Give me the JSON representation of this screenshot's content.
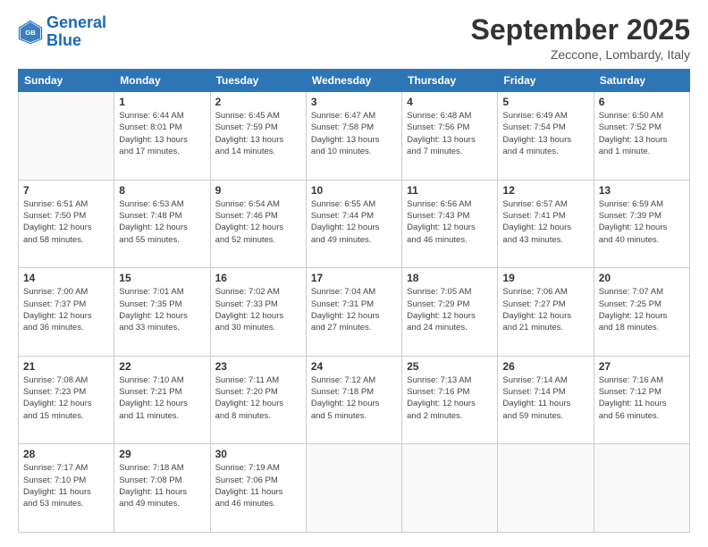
{
  "logo": {
    "text_general": "General",
    "text_blue": "Blue"
  },
  "header": {
    "month_title": "September 2025",
    "location": "Zeccone, Lombardy, Italy"
  },
  "days_of_week": [
    "Sunday",
    "Monday",
    "Tuesday",
    "Wednesday",
    "Thursday",
    "Friday",
    "Saturday"
  ],
  "weeks": [
    [
      {
        "day": "",
        "info": ""
      },
      {
        "day": "1",
        "info": "Sunrise: 6:44 AM\nSunset: 8:01 PM\nDaylight: 13 hours\nand 17 minutes."
      },
      {
        "day": "2",
        "info": "Sunrise: 6:45 AM\nSunset: 7:59 PM\nDaylight: 13 hours\nand 14 minutes."
      },
      {
        "day": "3",
        "info": "Sunrise: 6:47 AM\nSunset: 7:58 PM\nDaylight: 13 hours\nand 10 minutes."
      },
      {
        "day": "4",
        "info": "Sunrise: 6:48 AM\nSunset: 7:56 PM\nDaylight: 13 hours\nand 7 minutes."
      },
      {
        "day": "5",
        "info": "Sunrise: 6:49 AM\nSunset: 7:54 PM\nDaylight: 13 hours\nand 4 minutes."
      },
      {
        "day": "6",
        "info": "Sunrise: 6:50 AM\nSunset: 7:52 PM\nDaylight: 13 hours\nand 1 minute."
      }
    ],
    [
      {
        "day": "7",
        "info": "Sunrise: 6:51 AM\nSunset: 7:50 PM\nDaylight: 12 hours\nand 58 minutes."
      },
      {
        "day": "8",
        "info": "Sunrise: 6:53 AM\nSunset: 7:48 PM\nDaylight: 12 hours\nand 55 minutes."
      },
      {
        "day": "9",
        "info": "Sunrise: 6:54 AM\nSunset: 7:46 PM\nDaylight: 12 hours\nand 52 minutes."
      },
      {
        "day": "10",
        "info": "Sunrise: 6:55 AM\nSunset: 7:44 PM\nDaylight: 12 hours\nand 49 minutes."
      },
      {
        "day": "11",
        "info": "Sunrise: 6:56 AM\nSunset: 7:43 PM\nDaylight: 12 hours\nand 46 minutes."
      },
      {
        "day": "12",
        "info": "Sunrise: 6:57 AM\nSunset: 7:41 PM\nDaylight: 12 hours\nand 43 minutes."
      },
      {
        "day": "13",
        "info": "Sunrise: 6:59 AM\nSunset: 7:39 PM\nDaylight: 12 hours\nand 40 minutes."
      }
    ],
    [
      {
        "day": "14",
        "info": "Sunrise: 7:00 AM\nSunset: 7:37 PM\nDaylight: 12 hours\nand 36 minutes."
      },
      {
        "day": "15",
        "info": "Sunrise: 7:01 AM\nSunset: 7:35 PM\nDaylight: 12 hours\nand 33 minutes."
      },
      {
        "day": "16",
        "info": "Sunrise: 7:02 AM\nSunset: 7:33 PM\nDaylight: 12 hours\nand 30 minutes."
      },
      {
        "day": "17",
        "info": "Sunrise: 7:04 AM\nSunset: 7:31 PM\nDaylight: 12 hours\nand 27 minutes."
      },
      {
        "day": "18",
        "info": "Sunrise: 7:05 AM\nSunset: 7:29 PM\nDaylight: 12 hours\nand 24 minutes."
      },
      {
        "day": "19",
        "info": "Sunrise: 7:06 AM\nSunset: 7:27 PM\nDaylight: 12 hours\nand 21 minutes."
      },
      {
        "day": "20",
        "info": "Sunrise: 7:07 AM\nSunset: 7:25 PM\nDaylight: 12 hours\nand 18 minutes."
      }
    ],
    [
      {
        "day": "21",
        "info": "Sunrise: 7:08 AM\nSunset: 7:23 PM\nDaylight: 12 hours\nand 15 minutes."
      },
      {
        "day": "22",
        "info": "Sunrise: 7:10 AM\nSunset: 7:21 PM\nDaylight: 12 hours\nand 11 minutes."
      },
      {
        "day": "23",
        "info": "Sunrise: 7:11 AM\nSunset: 7:20 PM\nDaylight: 12 hours\nand 8 minutes."
      },
      {
        "day": "24",
        "info": "Sunrise: 7:12 AM\nSunset: 7:18 PM\nDaylight: 12 hours\nand 5 minutes."
      },
      {
        "day": "25",
        "info": "Sunrise: 7:13 AM\nSunset: 7:16 PM\nDaylight: 12 hours\nand 2 minutes."
      },
      {
        "day": "26",
        "info": "Sunrise: 7:14 AM\nSunset: 7:14 PM\nDaylight: 11 hours\nand 59 minutes."
      },
      {
        "day": "27",
        "info": "Sunrise: 7:16 AM\nSunset: 7:12 PM\nDaylight: 11 hours\nand 56 minutes."
      }
    ],
    [
      {
        "day": "28",
        "info": "Sunrise: 7:17 AM\nSunset: 7:10 PM\nDaylight: 11 hours\nand 53 minutes."
      },
      {
        "day": "29",
        "info": "Sunrise: 7:18 AM\nSunset: 7:08 PM\nDaylight: 11 hours\nand 49 minutes."
      },
      {
        "day": "30",
        "info": "Sunrise: 7:19 AM\nSunset: 7:06 PM\nDaylight: 11 hours\nand 46 minutes."
      },
      {
        "day": "",
        "info": ""
      },
      {
        "day": "",
        "info": ""
      },
      {
        "day": "",
        "info": ""
      },
      {
        "day": "",
        "info": ""
      }
    ]
  ]
}
